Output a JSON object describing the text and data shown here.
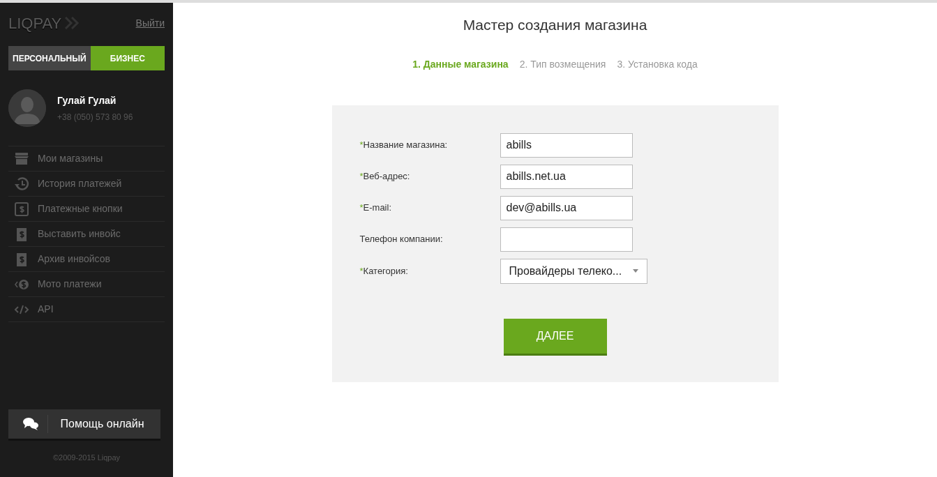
{
  "sidebar": {
    "logo": "LIQPAY",
    "logout": "Выйти",
    "account_tabs": [
      {
        "label": "ПЕРСОНАЛЬНЫЙ",
        "selected": false
      },
      {
        "label": "БИЗНЕС",
        "selected": true
      }
    ],
    "user": {
      "name": "Гулай Гулай",
      "phone": "+38 (050) 573 80 96"
    },
    "menu": [
      {
        "label": "Мои магазины"
      },
      {
        "label": "История платежей"
      },
      {
        "label": "Платежные кнопки"
      },
      {
        "label": "Выставить инвойс"
      },
      {
        "label": "Архив инвойсов"
      },
      {
        "label": "Мото платежи"
      },
      {
        "label": "API"
      }
    ],
    "help_button": "Помощь онлайн",
    "copyright": "©2009-2015 Liqpay"
  },
  "main": {
    "title": "Мастер создания магазина",
    "steps": [
      {
        "label": "1. Данные магазина",
        "selected": true
      },
      {
        "label": "2. Тип возмещения",
        "selected": false
      },
      {
        "label": "3. Установка кода",
        "selected": false
      }
    ],
    "fields": [
      {
        "kind": "input",
        "marker": "*",
        "label": "Название магазина:",
        "value": "abills"
      },
      {
        "kind": "input",
        "marker": "*",
        "label": "Веб-адрес:",
        "value": "abills.net.ua"
      },
      {
        "kind": "input",
        "marker": "*",
        "label": "E-mail:",
        "value": "dev@abills.ua"
      },
      {
        "kind": "input",
        "label": "Телефон компании:"
      },
      {
        "kind": "select",
        "marker": "*",
        "label": "Категория:",
        "value": "Провайдеры телеко..."
      }
    ],
    "next_button": "ДАЛЕЕ"
  }
}
